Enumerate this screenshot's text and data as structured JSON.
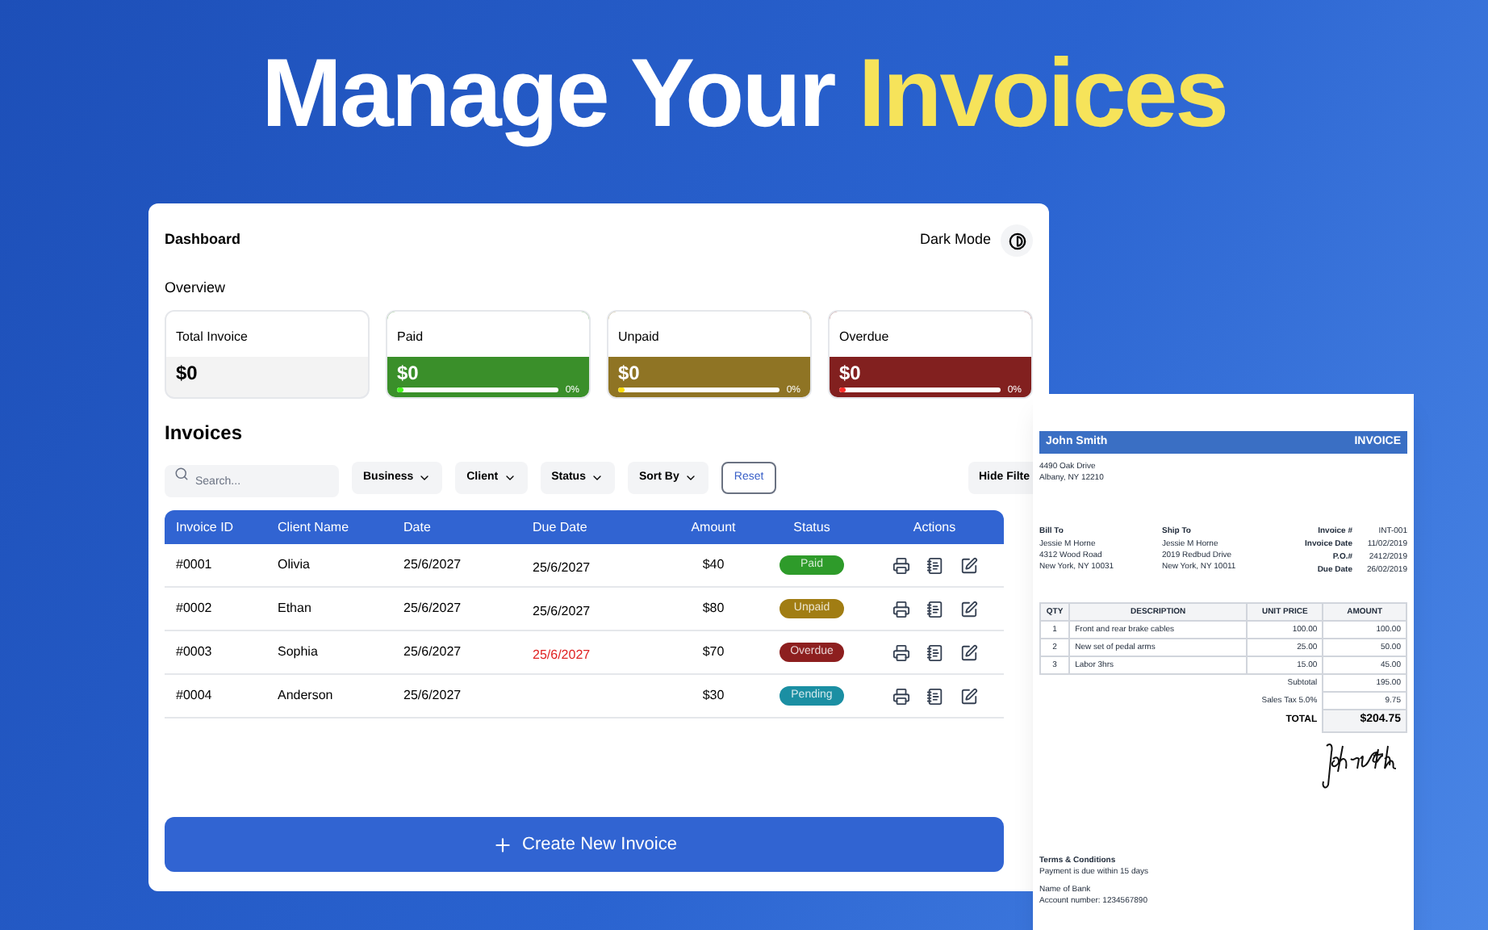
{
  "headline": {
    "lead": "Manage Your",
    "highlight": "Invoices"
  },
  "dashboard": {
    "title": "Dashboard",
    "dark_mode": {
      "label": "Dark Mode"
    },
    "overview_title": "Overview",
    "cards": [
      {
        "kind": "plain",
        "label": "Total Invoice",
        "value": "$0",
        "color": "#f3f3f3"
      },
      {
        "kind": "progress",
        "label": "Paid",
        "value": "$0",
        "color": "#3a8f2a",
        "level": 0,
        "reading": "0%"
      },
      {
        "kind": "progress",
        "label": "Unpaid",
        "value": "$0",
        "color": "#8f7424",
        "level": 0,
        "reading": "0%"
      },
      {
        "kind": "progress",
        "label": "Overdue",
        "value": "$0",
        "color": "#82201f",
        "level": 0,
        "reading": "0%"
      }
    ]
  },
  "invoices": {
    "title": "Invoices",
    "search": {
      "placeholder": "Search..."
    },
    "filters": [
      "Business",
      "Client",
      "Status",
      "Sort By"
    ],
    "reset": "Reset",
    "hide_filters": "Hide Filte",
    "columns": [
      "Invoice ID",
      "Client Name",
      "Date",
      "Due Date",
      "Amount",
      "Status",
      "Actions"
    ],
    "rows": [
      {
        "id": "#0001",
        "client": "Olivia",
        "date": "25/6/2027",
        "due": "25/6/2027",
        "overdue": false,
        "amount": "$40",
        "status": "Paid",
        "color": "#2e9b2a"
      },
      {
        "id": "#0002",
        "client": "Ethan",
        "date": "25/6/2027",
        "due": "25/6/2027",
        "overdue": false,
        "amount": "$80",
        "status": "Unpaid",
        "color": "#a17d13"
      },
      {
        "id": "#0003",
        "client": "Sophia",
        "date": "25/6/2027",
        "due": "25/6/2027",
        "overdue": true,
        "amount": "$70",
        "status": "Overdue",
        "color": "#8d1f1f"
      },
      {
        "id": "#0004",
        "client": "Anderson",
        "date": "25/6/2027",
        "amount": "$30",
        "status": "Pending",
        "color": "#1b8fa3"
      }
    ],
    "create_button": "Create New Invoice"
  },
  "document": {
    "name": "John Smith",
    "heading": "INVOICE",
    "address": [
      "4490 Oak Drive",
      "Albany, NY 12210"
    ],
    "bill_to": {
      "title": "Bill To",
      "lines": [
        "Jessie M Horne",
        "4312 Wood Road",
        "New York, NY 10031"
      ]
    },
    "ship_to": {
      "title": "Ship To",
      "lines": [
        "Jessie M Horne",
        "2019 Redbud Drive",
        "New York, NY 10011"
      ]
    },
    "meta": [
      {
        "label": "Invoice #",
        "value": "INT-001"
      },
      {
        "label": "Invoice Date",
        "value": "11/02/2019"
      },
      {
        "label": "P.O.#",
        "value": "2412/2019"
      },
      {
        "label": "Due Date",
        "value": "26/02/2019"
      }
    ],
    "columns": [
      "QTY",
      "DESCRIPTION",
      "UNIT PRICE",
      "AMOUNT"
    ],
    "items": [
      [
        "1",
        "Front and rear brake cables",
        "100.00",
        "100.00"
      ],
      [
        "2",
        "New set of pedal arms",
        "25.00",
        "50.00"
      ],
      [
        "3",
        "Labor 3hrs",
        "15.00",
        "45.00"
      ]
    ],
    "totals": [
      {
        "label": "Subtotal",
        "value": "195.00"
      },
      {
        "label": "Sales Tax 5.0%",
        "value": "9.75"
      }
    ],
    "total": {
      "label": "TOTAL",
      "value": "$204.75"
    },
    "terms": {
      "title": "Terms & Conditions",
      "text": "Payment is due within 15 days"
    },
    "bank": [
      "Name of Bank",
      "Account number: 1234567890"
    ]
  }
}
